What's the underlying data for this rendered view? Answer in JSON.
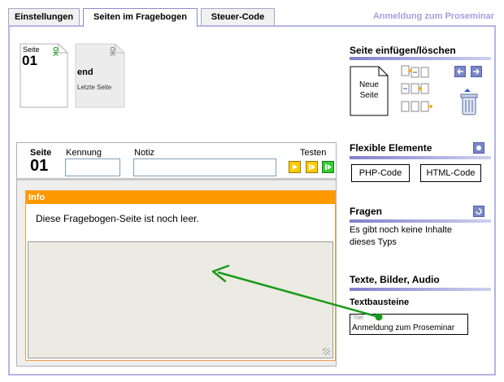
{
  "tabs": [
    {
      "label": "Einstellungen",
      "active": false
    },
    {
      "label": "Seiten im Fragebogen",
      "active": true
    },
    {
      "label": "Steuer-Code",
      "active": false
    }
  ],
  "app_title": "Anmeldung zum Proseminar",
  "pages": [
    {
      "small": "Seite",
      "big": "01",
      "ok": "OK"
    },
    {
      "big": "end",
      "sub": "Letzte Seite",
      "ok": "OK"
    }
  ],
  "editor": {
    "page_label": "Seite",
    "page_number": "01",
    "id_label": "Kennung",
    "id_value": "",
    "note_label": "Notiz",
    "note_value": "",
    "test_label": "Testen",
    "info_title": "Info",
    "info_text": "Diese Fragebogen-Seite ist noch leer."
  },
  "sections": {
    "insert": {
      "title": "Seite einfügen/löschen",
      "new_page_label_1": "Neue",
      "new_page_label_2": "Seite"
    },
    "flexible": {
      "title": "Flexible Elemente",
      "php_button": "PHP-Code",
      "html_button": "HTML-Code"
    },
    "questions": {
      "title": "Fragen",
      "empty_text_1": "Es gibt noch keine Inhalte",
      "empty_text_2": "dieses Typs"
    },
    "media": {
      "title": "Texte, Bilder, Audio",
      "subtitle": "Textbausteine",
      "item_label": "Titel",
      "item_value": "Anmeldung zum Proseminar"
    }
  },
  "colors": {
    "accent": "#8080cc",
    "info_orange": "#ff9900",
    "ok_green": "#2a9a2a",
    "arrow_green": "#1a9a1a",
    "play_yellow": "#ffcc00",
    "play_green": "#33cc33"
  }
}
